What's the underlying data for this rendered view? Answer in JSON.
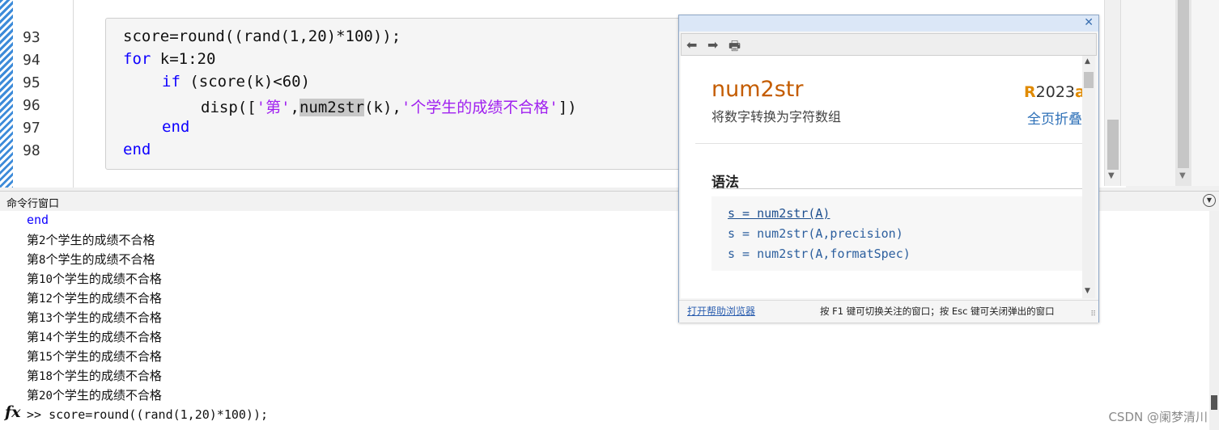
{
  "editor": {
    "line_numbers": [
      "93",
      "94",
      "95",
      "96",
      "97",
      "98"
    ],
    "code": {
      "l93": "score=round((rand(1,20)*100));",
      "l94_kw": "for",
      "l94_rest": " k=1:20",
      "l95_kw": "if",
      "l95_rest": " (score(k)<60)",
      "l96_a": "disp([",
      "l96_str1": "'第'",
      "l96_comma1": ",",
      "l96_hl": "num2str",
      "l96_b": "(k),",
      "l96_str2": "'个学生的成绩不合格'",
      "l96_c": "])",
      "l97_kw": "end",
      "l98_kw": "end"
    }
  },
  "command_window": {
    "title": "命令行窗口",
    "first_line": "end",
    "outputs": [
      {
        "prefix": "第",
        "num": "2",
        "suffix": "个学生的成绩不合格"
      },
      {
        "prefix": "第",
        "num": "8",
        "suffix": "个学生的成绩不合格"
      },
      {
        "prefix": "第",
        "num": "10",
        "suffix": "个学生的成绩不合格"
      },
      {
        "prefix": "第",
        "num": "12",
        "suffix": "个学生的成绩不合格"
      },
      {
        "prefix": "第",
        "num": "13",
        "suffix": "个学生的成绩不合格"
      },
      {
        "prefix": "第",
        "num": "14",
        "suffix": "个学生的成绩不合格"
      },
      {
        "prefix": "第",
        "num": "15",
        "suffix": "个学生的成绩不合格"
      },
      {
        "prefix": "第",
        "num": "18",
        "suffix": "个学生的成绩不合格"
      },
      {
        "prefix": "第",
        "num": "20",
        "suffix": "个学生的成绩不合格"
      }
    ],
    "fx_icon": "fx",
    "prompt": ">> score=round((rand(1,20)*100));"
  },
  "help_popup": {
    "close_glyph": "✕",
    "toolbar_icons": [
      "back-icon",
      "forward-icon",
      "print-icon"
    ],
    "function_name": "num2str",
    "description": "将数字转换为字符数组",
    "release_r": "R",
    "release_year": "2023",
    "release_a": "a",
    "collapse_all": "全页折叠",
    "syntax_heading": "语法",
    "syntax": [
      "s = num2str(A)",
      "s = num2str(A,precision)",
      "s = num2str(A,formatSpec)"
    ],
    "open_help_browser": "打开帮助浏览器",
    "footer_tip": "按 F1 键可切换关注的窗口；按 Esc 键可关闭弹出的窗口"
  },
  "watermark": "CSDN @阑梦清川",
  "colors": {
    "keyword": "#0e00ff",
    "string": "#a020f0",
    "help_title": "#c45c00",
    "link": "#2c6fb7"
  }
}
